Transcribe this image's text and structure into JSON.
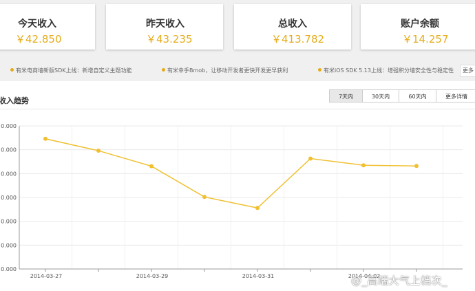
{
  "stats": [
    {
      "label": "今天收入",
      "value": "￥42.850"
    },
    {
      "label": "昨天收入",
      "value": "￥43.235"
    },
    {
      "label": "总收入",
      "value": "￥413.782"
    },
    {
      "label": "账户余额",
      "value": "￥14.257"
    }
  ],
  "news": {
    "items": [
      "有米电商墙新版SDK上线：新增自定义主题功能",
      "有米幸手Bmob，让移动开发者更快开发更早获利",
      "有米iOS SDK 5.13上线：增强积分墙安全性与稳定性"
    ],
    "more_label": "更多"
  },
  "panel": {
    "title": "收入趋势",
    "tabs": [
      "7天内",
      "30天内",
      "60天内",
      "更多详情"
    ],
    "active_tab": "7天内"
  },
  "chart_data": {
    "type": "line",
    "x": [
      "2014-03-27",
      "2014-03-28",
      "2014-03-29",
      "2014-03-30",
      "2014-03-31",
      "2014-04-01",
      "2014-04-02",
      "2014-04-03"
    ],
    "x_tick_labels": [
      "2014-03-27",
      "",
      "2014-03-29",
      "",
      "2014-03-31",
      "",
      "2014-04-02",
      ""
    ],
    "y_tick_labels": [
      "0.000",
      "0.000",
      "0.000",
      "0.000",
      "0.000",
      "0.000",
      "0.000"
    ],
    "values": [
      54.6,
      49.6,
      43.1,
      30.2,
      25.6,
      46.3,
      43.5,
      43.2
    ],
    "ylim": [
      0,
      60
    ],
    "line_color": "#f0c030",
    "grid": true
  },
  "watermark": "@_高端大气上档次_"
}
